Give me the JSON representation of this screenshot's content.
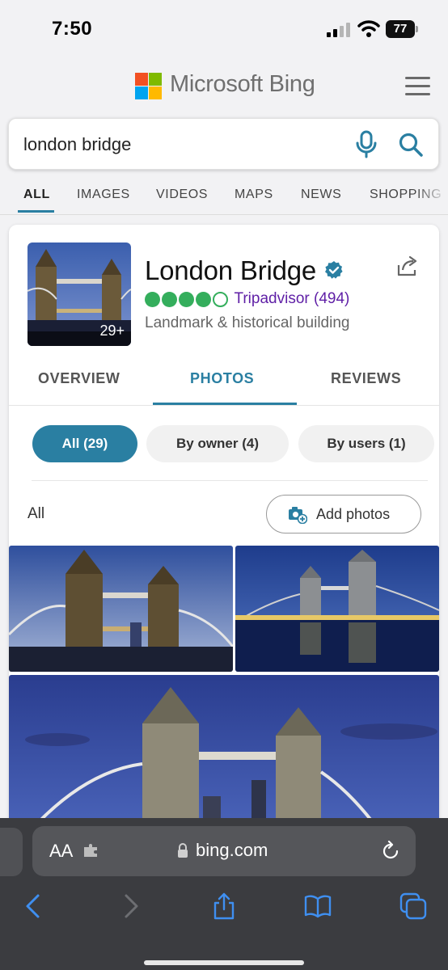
{
  "status_bar": {
    "time": "7:50",
    "battery": "77"
  },
  "header": {
    "brand": "Microsoft Bing"
  },
  "search": {
    "query": "london bridge"
  },
  "nav_tabs": [
    "ALL",
    "IMAGES",
    "VIDEOS",
    "MAPS",
    "NEWS",
    "SHOPPING"
  ],
  "entity": {
    "title": "London Bridge",
    "thumb_count": "29+",
    "rating_dots": 4,
    "rating_max": 5,
    "rating_source": "Tripadvisor (494)",
    "category": "Landmark & historical building"
  },
  "sub_tabs": [
    "OVERVIEW",
    "PHOTOS",
    "REVIEWS"
  ],
  "filters": [
    "All (29)",
    "By owner (4)",
    "By users (1)"
  ],
  "photos_section": {
    "label": "All",
    "add_button": "Add photos"
  },
  "browser": {
    "domain": "bing.com",
    "text_size": "AA"
  },
  "colors": {
    "accent": "#2a7fa2",
    "rating": "#34ae5c",
    "tripadvisor_link": "#5f1fa6"
  }
}
